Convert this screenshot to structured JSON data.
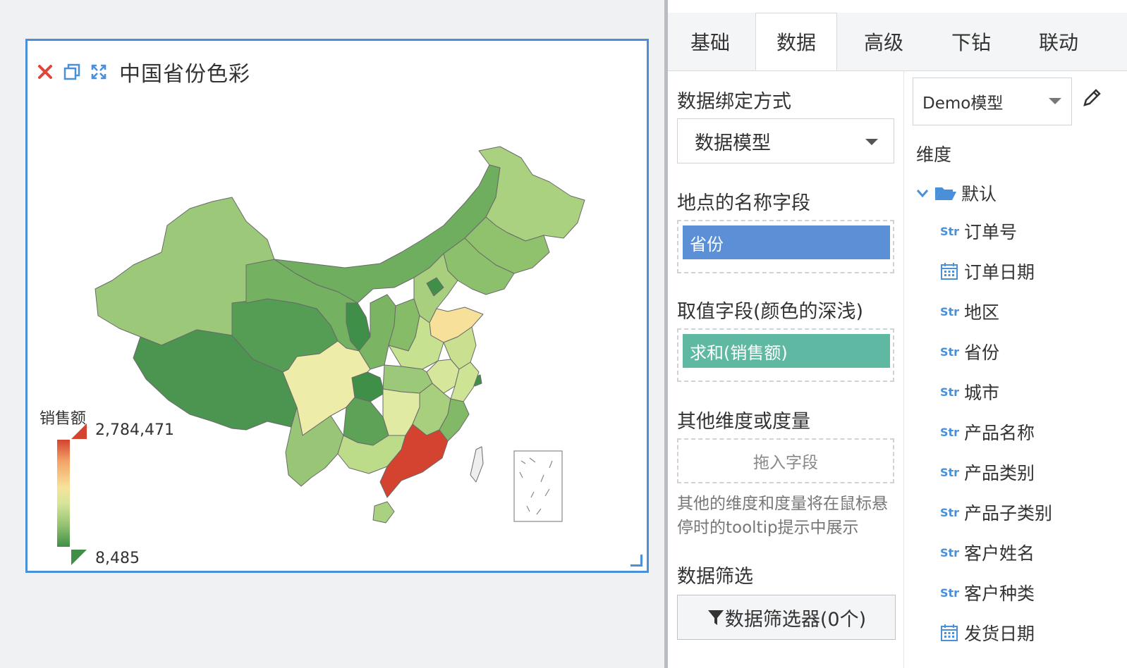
{
  "widget": {
    "title": "中国省份色彩",
    "icons": [
      "close-icon",
      "copy-icon",
      "fullscreen-icon"
    ],
    "legend": {
      "title": "销售额",
      "max_label": "2,784,471",
      "min_label": "8,485"
    },
    "colors": {
      "accent_border": "#4a90d9",
      "max": "#d34330",
      "min": "#3f8f48"
    }
  },
  "chart_data": {
    "type": "heatmap",
    "title": "中国省份色彩",
    "legend": {
      "title": "销售额",
      "max": 2784471,
      "min": 8485,
      "placement": "bottom-left"
    },
    "notes_visible": "Choropleth map of Chinese provinces; Guangdong highlighted red (max), Shandong pale yellow, Sichuan pale yellow, western provinces dark green"
  },
  "tabs": [
    {
      "label": "基础",
      "active": false
    },
    {
      "label": "数据",
      "active": true
    },
    {
      "label": "高级",
      "active": false
    },
    {
      "label": "下钻",
      "active": false
    },
    {
      "label": "联动",
      "active": false
    }
  ],
  "settings": {
    "binding_label": "数据绑定方式",
    "binding_value": "数据模型",
    "location_label": "地点的名称字段",
    "location_chip": "省份",
    "value_label": "取值字段(颜色的深浅)",
    "value_chip": "求和(销售额)",
    "other_label": "其他维度或度量",
    "other_placeholder": "拖入字段",
    "help_text": "其他的维度和度量将在鼠标悬停时的tooltip提示中展示",
    "filter_label": "数据筛选",
    "filter_button": "数据筛选器(0个)"
  },
  "fields": {
    "model": "Demo模型",
    "dimension_label": "维度",
    "folder": "默认",
    "items": [
      {
        "type": "Str",
        "label": "订单号"
      },
      {
        "type": "date",
        "label": "订单日期"
      },
      {
        "type": "Str",
        "label": "地区"
      },
      {
        "type": "Str",
        "label": "省份"
      },
      {
        "type": "Str",
        "label": "城市"
      },
      {
        "type": "Str",
        "label": "产品名称"
      },
      {
        "type": "Str",
        "label": "产品类别"
      },
      {
        "type": "Str",
        "label": "产品子类别"
      },
      {
        "type": "Str",
        "label": "客户姓名"
      },
      {
        "type": "Str",
        "label": "客户种类"
      },
      {
        "type": "date",
        "label": "发货日期"
      }
    ]
  }
}
